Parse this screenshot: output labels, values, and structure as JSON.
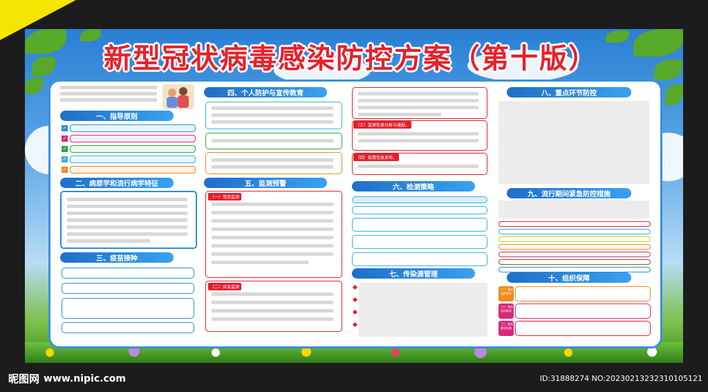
{
  "title": "新型冠状病毒感染防控方案（第十版）",
  "sections": {
    "s1": "一、指导原则",
    "s2": "二、病原学和流行病学特征",
    "s3": "三、疫苗接种",
    "s4": "四、个人防护与宣传教育",
    "s5": "五、监测预警",
    "s6": "六、检测策略",
    "s7": "七、传染源管理",
    "s8": "八、重点环节防控",
    "s9": "九、流行期间紧急防控措施",
    "s10": "十、组织保障"
  },
  "tags": {
    "t1": "（一）常态监测",
    "t2": "（二）应急监测",
    "t3": "（三）监测信息分析与通报。",
    "t4": "（四）疫情信息发布。"
  },
  "org_labels": [
    "（一）强化组织领导",
    "（二）强化培训指导",
    "（三）强化督导检查"
  ],
  "footer": {
    "logo": "昵图网",
    "url": "www.nipic.com",
    "id": "ID:31888274 NO:20230213232310105121"
  },
  "colors": {
    "title": "#e8202a",
    "section": "#1e6fc8",
    "accent": "#f2c400",
    "tag": "#e0202c"
  }
}
